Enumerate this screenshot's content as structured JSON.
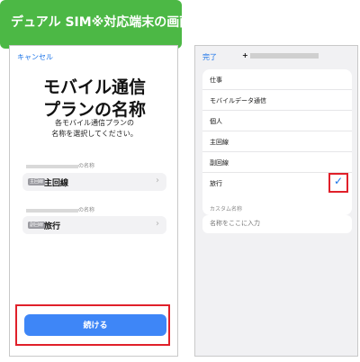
{
  "callout": {
    "title": "デュアル SIM※対応端末の画面",
    "color": "#4cb845"
  },
  "left_screen": {
    "cancel_label": "キャンセル",
    "title_line1": "モバイル通信",
    "title_line2": "プランの名称",
    "subtitle_line1": "各モバイル通信プランの",
    "subtitle_line2": "名称を選択してください。",
    "lines": [
      {
        "label_suffix": "の名称",
        "badge": "主回線",
        "name": "主回線"
      },
      {
        "label_suffix": "の名称",
        "badge": "副回線",
        "name": "旅行"
      }
    ],
    "chevron": "›",
    "continue_label": "続ける",
    "accent": "#3e86f7",
    "highlight_color": "#e0202a"
  },
  "right_screen": {
    "done_label": "完了",
    "phone_prefix": "+",
    "items": [
      "仕事",
      "モバイルデータ通信",
      "個人",
      "主回線",
      "副回線",
      "旅行"
    ],
    "selected_item": "旅行",
    "checkmark": "✓",
    "custom_name_label": "カスタム名称",
    "custom_name_placeholder": "名称をここに入力"
  }
}
